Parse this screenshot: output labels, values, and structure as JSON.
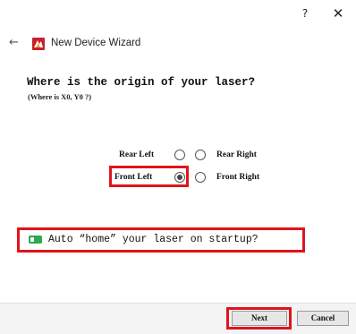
{
  "window": {
    "help_label": "?",
    "close_label": "✕"
  },
  "header": {
    "back_label": "←",
    "title": "New Device Wizard"
  },
  "question": {
    "main": "Where is the origin of your laser?",
    "sub": "(Where is X0, Y0 ?)"
  },
  "origin_options": {
    "rear_left": "Rear Left",
    "rear_right": "Rear Right",
    "front_left": "Front Left",
    "front_right": "Front Right",
    "selected": "Front Left"
  },
  "auto_home": {
    "label": "Auto “home” your laser on startup?",
    "enabled": true
  },
  "buttons": {
    "next": "Next",
    "cancel": "Cancel"
  },
  "colors": {
    "highlight": "#e0141b",
    "toggle_on": "#2fa84f"
  }
}
